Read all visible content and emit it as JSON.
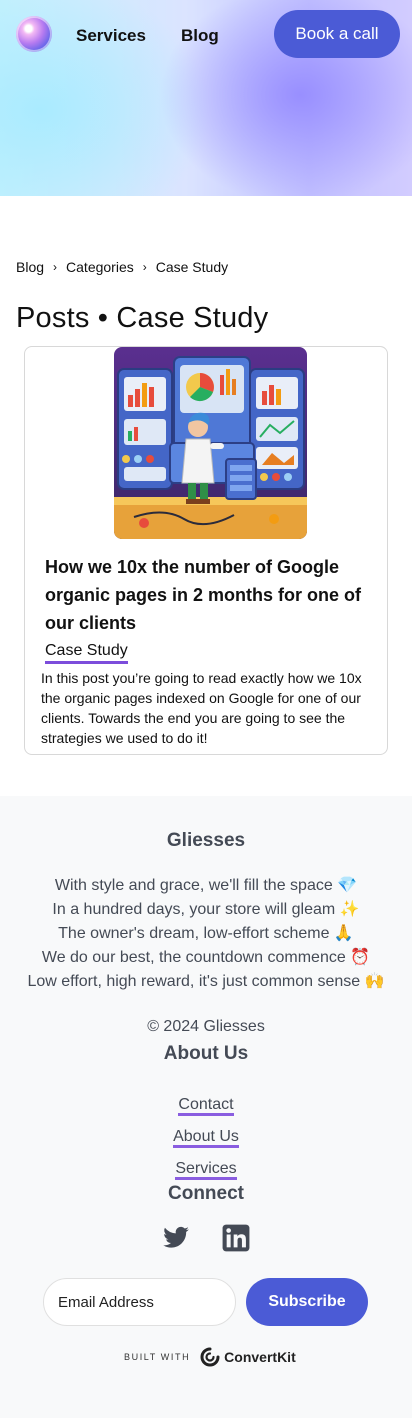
{
  "header": {
    "nav": [
      {
        "label": "Services"
      },
      {
        "label": "Blog"
      }
    ],
    "cta_label": "Book a call"
  },
  "breadcrumb": [
    "Blog",
    "Categories",
    "Case Study"
  ],
  "page_title": "Posts • Case Study",
  "post": {
    "image_icon": "illustration-scientist-dashboard",
    "title": "How we 10x the number of Google organic pages in 2 months for one of our clients",
    "tag": "Case Study",
    "excerpt": "In this post you’re going to read exactly how we 10x the organic pages indexed on Google for one of our clients. Towards the end you are going to see the strategies we used to do it!"
  },
  "footer": {
    "brand": "Gliesses",
    "poem": [
      "With style and grace, we'll fill the space 💎",
      "In a hundred days, your store will gleam ✨",
      "The owner's dream, low-effort scheme 🙏",
      "We do our best, the countdown commence ⏰",
      "Low effort, high reward, it's just common sense 🙌"
    ],
    "copyright": "© 2024 Gliesses",
    "about_heading": "About Us",
    "links": [
      {
        "label": "Contact"
      },
      {
        "label": "About Us"
      },
      {
        "label": "Services"
      }
    ],
    "connect_heading": "Connect",
    "social": [
      "twitter-icon",
      "linkedin-icon"
    ],
    "email_placeholder": "Email Address",
    "subscribe_label": "Subscribe",
    "built_with": "BUILT WITH",
    "built_brand": "ConvertKit"
  },
  "colors": {
    "accent": "#4b5bd6",
    "link_underline": "#8a5de0",
    "footer_bg": "#f8f9fa"
  }
}
